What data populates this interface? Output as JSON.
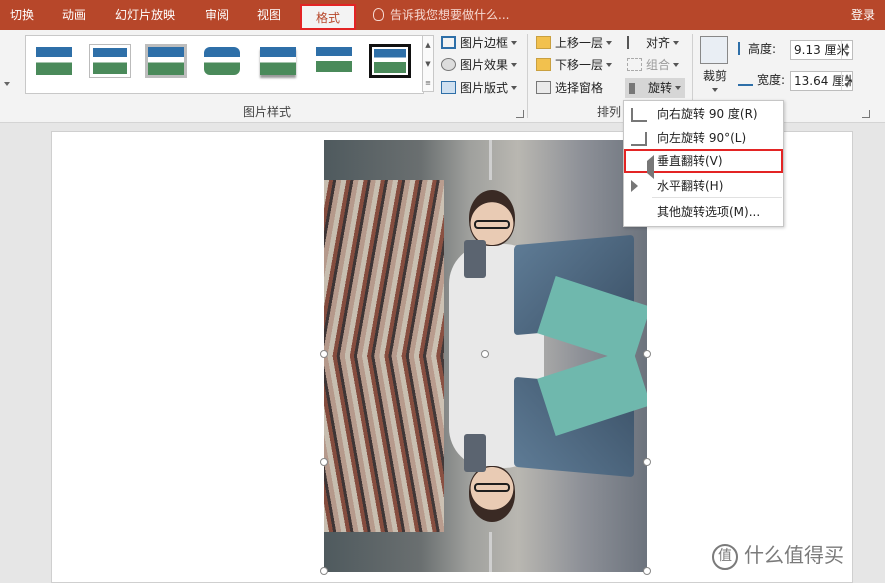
{
  "tabs": [
    {
      "label": "切换",
      "active": false
    },
    {
      "label": "动画",
      "active": false
    },
    {
      "label": "幻灯片放映",
      "active": false
    },
    {
      "label": "审阅",
      "active": false
    },
    {
      "label": "视图",
      "active": false
    },
    {
      "label": "格式",
      "active": true
    }
  ],
  "tell_me": "告诉我您想要做什么...",
  "login": "登录",
  "ribbon": {
    "picture_styles_group": "图片样式",
    "picture_border": "图片边框",
    "picture_effects": "图片效果",
    "picture_layout": "图片版式",
    "bring_forward": "上移一层",
    "send_backward": "下移一层",
    "selection_pane": "选择窗格",
    "arrange_group": "排列",
    "align": "对齐",
    "group": "组合",
    "rotate": "旋转",
    "crop": "裁剪",
    "height_label": "高度:",
    "height_value": "9.13 厘米",
    "width_label": "宽度:",
    "width_value": "13.64 厘米"
  },
  "rotate_menu": {
    "items": [
      {
        "label": "向右旋转 90 度(R)",
        "icon": "rotate-right-icon"
      },
      {
        "label": "向左旋转 90°(L)",
        "icon": "rotate-left-icon"
      },
      {
        "label": "垂直翻转(V)",
        "icon": "flip-vertical-icon",
        "highlighted": true
      },
      {
        "label": "水平翻转(H)",
        "icon": "flip-horizontal-icon"
      },
      {
        "label": "其他旋转选项(M)...",
        "icon": ""
      }
    ]
  },
  "watermark": "什么值得买",
  "watermark_logo": "值",
  "colors": {
    "accent": "#b7472a",
    "highlight_border": "#e32424"
  }
}
